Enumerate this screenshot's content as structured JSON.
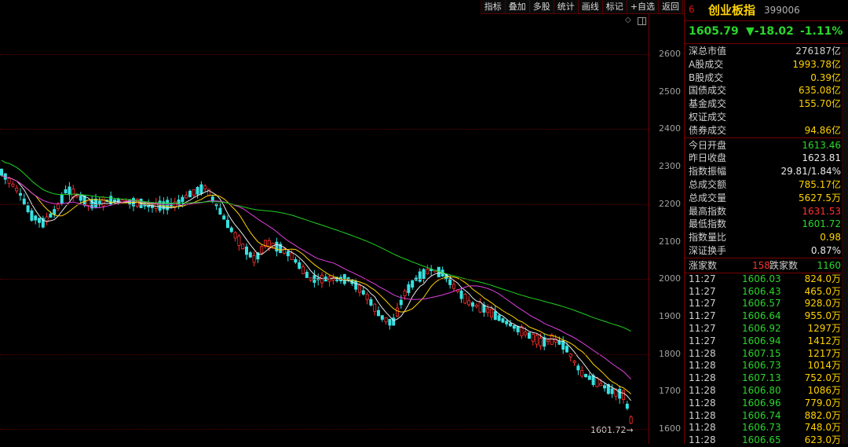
{
  "toolbar": [
    "指标",
    "叠加",
    "多股",
    "统计",
    "画线",
    "标记",
    "+自选",
    "返回"
  ],
  "axis": {
    "ticks": [
      "2600",
      "2500",
      "2400",
      "2300",
      "2200",
      "2100",
      "2000",
      "1900",
      "1800",
      "1700",
      "1600"
    ]
  },
  "low_marker": "1601.72→",
  "colors": {
    "up": "#ff3030",
    "down": "#38e0e0",
    "ma5": "#e8e8e8",
    "ma10": "#ffd200",
    "ma20": "#e040e0",
    "ma60": "#20d020",
    "border": "#7a0000"
  },
  "header": {
    "num": "6",
    "name": "创业板指",
    "code": "399006"
  },
  "price": {
    "last": "1605.79",
    "change": "▼-18.02",
    "pct": "-1.11%"
  },
  "market": [
    {
      "k": "深总市值",
      "v": "276187亿",
      "c": "#d0d0d0"
    },
    {
      "k": "A股成交",
      "v": "1993.78亿",
      "c": "#ffd200"
    },
    {
      "k": "B股成交",
      "v": "0.39亿",
      "c": "#ffd200"
    },
    {
      "k": "国债成交",
      "v": "635.08亿",
      "c": "#ffd200"
    },
    {
      "k": "基金成交",
      "v": "155.70亿",
      "c": "#ffd200"
    },
    {
      "k": "权证成交",
      "v": "",
      "c": "#ffd200"
    },
    {
      "k": "债券成交",
      "v": "94.86亿",
      "c": "#ffd200"
    }
  ],
  "stats": [
    {
      "k": "今日开盘",
      "v": "1613.46",
      "c": "#2bd52b"
    },
    {
      "k": "昨日收盘",
      "v": "1623.81",
      "c": "#e8e8e8"
    },
    {
      "k": "指数振幅",
      "v": "29.81/1.84%",
      "c": "#e8e8e8"
    },
    {
      "k": "总成交额",
      "v": "785.17亿",
      "c": "#ffd200"
    },
    {
      "k": "总成交量",
      "v": "5627.5万",
      "c": "#ffd200"
    },
    {
      "k": "最高指数",
      "v": "1631.53",
      "c": "#ff3030"
    },
    {
      "k": "最低指数",
      "v": "1601.72",
      "c": "#2bd52b"
    },
    {
      "k": "指数量比",
      "v": "0.98",
      "c": "#ffd200"
    },
    {
      "k": "深证换手",
      "v": "0.87%",
      "c": "#e8e8e8"
    }
  ],
  "updown": {
    "up_label": "涨家数",
    "up_value": "158",
    "down_label": "跌家数",
    "down_value": "1160"
  },
  "ticks": [
    {
      "t": "11:27",
      "p": "1606.03",
      "v": "824.0万"
    },
    {
      "t": "11:27",
      "p": "1606.43",
      "v": "465.0万"
    },
    {
      "t": "11:27",
      "p": "1606.57",
      "v": "928.0万"
    },
    {
      "t": "11:27",
      "p": "1606.64",
      "v": "955.0万"
    },
    {
      "t": "11:27",
      "p": "1606.92",
      "v": "1297万"
    },
    {
      "t": "11:27",
      "p": "1606.94",
      "v": "1412万"
    },
    {
      "t": "11:28",
      "p": "1607.15",
      "v": "1217万"
    },
    {
      "t": "11:28",
      "p": "1606.73",
      "v": "1014万"
    },
    {
      "t": "11:28",
      "p": "1607.13",
      "v": "752.0万"
    },
    {
      "t": "11:28",
      "p": "1606.80",
      "v": "1086万"
    },
    {
      "t": "11:28",
      "p": "1606.96",
      "v": "779.0万"
    },
    {
      "t": "11:28",
      "p": "1606.74",
      "v": "882.0万"
    },
    {
      "t": "11:28",
      "p": "1606.73",
      "v": "748.0万"
    },
    {
      "t": "11:28",
      "p": "1606.65",
      "v": "623.0万"
    }
  ]
}
